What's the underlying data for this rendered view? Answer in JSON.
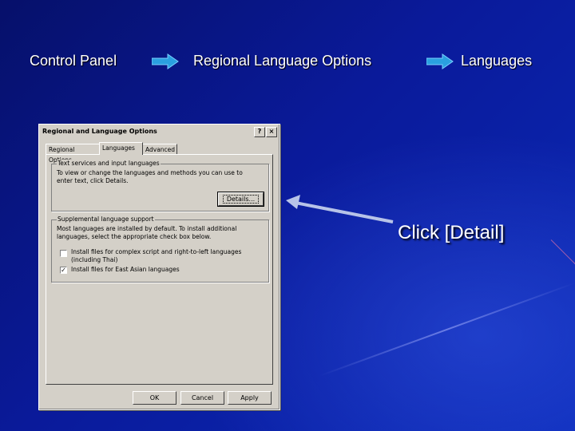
{
  "breadcrumb": {
    "step1": "Control Panel",
    "step2": "Regional Language Options",
    "step3": "Languages"
  },
  "callout": "Click [Detail]",
  "dialog": {
    "title": "Regional and Language Options",
    "help_button": "?",
    "close_button": "×",
    "tabs": [
      "Regional Options",
      "Languages",
      "Advanced"
    ],
    "text_services": {
      "label": "Text services and input languages",
      "description": "To view or change the languages and methods you can use to enter text, click Details.",
      "details_button": "Details..."
    },
    "supplemental": {
      "label": "Supplemental language support",
      "description": "Most languages are installed by default. To install additional languages, select the appropriate check box below.",
      "option1": "Install files for complex script and right-to-left languages (including Thai)",
      "option1_checked": false,
      "option2": "Install files for East Asian languages",
      "option2_checked": true
    },
    "buttons": {
      "ok": "OK",
      "cancel": "Cancel",
      "apply": "Apply"
    }
  },
  "colors": {
    "background": "#0a1a9a",
    "arrow": "#2aa0e0",
    "dialog": "#d4d0c8"
  }
}
